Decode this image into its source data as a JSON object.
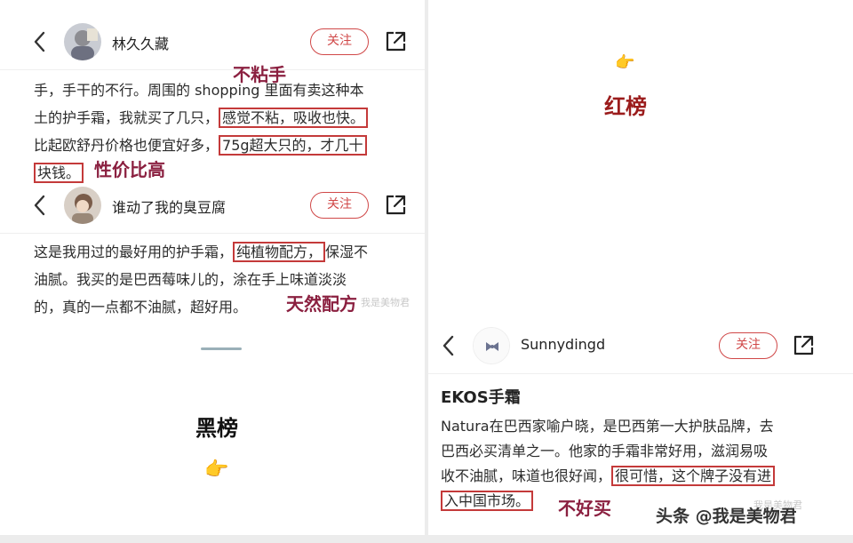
{
  "post1": {
    "username": "林久久藏",
    "follow_label": "关注",
    "lines": [
      {
        "segments": [
          {
            "t": "手，手干的不行。周围的 shopping 里面有卖这种本",
            "hl": false
          }
        ]
      },
      {
        "segments": [
          {
            "t": "土的护手霜，我就买了几只，",
            "hl": false
          },
          {
            "t": "感觉不粘，吸收也快。",
            "hl": true
          }
        ]
      },
      {
        "segments": [
          {
            "t": "比起欧舒丹价格也便宜好多，",
            "hl": false
          },
          {
            "t": "75g超大只的，才几十",
            "hl": true
          }
        ]
      },
      {
        "segments": [
          {
            "t": "块钱。",
            "hl": true
          }
        ]
      }
    ],
    "annotation_top": "不粘手",
    "annotation_price": "性价比高"
  },
  "post2": {
    "username": "谁动了我的臭豆腐",
    "follow_label": "关注",
    "lines": [
      {
        "segments": [
          {
            "t": "这是我用过的最好用的护手霜，",
            "hl": false
          },
          {
            "t": "纯植物配方，",
            "hl": true
          },
          {
            "t": "保湿不",
            "hl": false
          }
        ]
      },
      {
        "segments": [
          {
            "t": "油腻。我买的是巴西莓味儿的，涂在手上味道淡淡",
            "hl": false
          }
        ]
      },
      {
        "segments": [
          {
            "t": "的，真的一点都不油腻，超好用。",
            "hl": false
          }
        ]
      }
    ],
    "annotation": "天然配方",
    "watermark": "我是美物君"
  },
  "black_list_label": "黑榜",
  "red_list_label": "红榜",
  "post3": {
    "username": "Sunnydingd",
    "follow_label": "关注",
    "product_title": "EKOS手霜",
    "lines": [
      {
        "segments": [
          {
            "t": "Natura在巴西家喻户晓，是巴西第一大护肤品牌，去",
            "hl": false
          }
        ]
      },
      {
        "segments": [
          {
            "t": "巴西必买清单之一。他家的手霜非常好用，滋润易吸",
            "hl": false
          }
        ]
      },
      {
        "segments": [
          {
            "t": "收不油腻，味道也很好闻，",
            "hl": false
          },
          {
            "t": "很可惜，这个牌子没有进",
            "hl": true
          }
        ]
      },
      {
        "segments": [
          {
            "t": "入中国市场。",
            "hl": true
          }
        ]
      }
    ],
    "annotation": "不好买",
    "watermark": "我是美物君"
  },
  "footer_watermark": "头条 @我是美物君",
  "colors": {
    "accent_red": "#d04848",
    "box_red": "#c43a3a",
    "annotation": "#8b2040",
    "rank_red": "#9b1c1c"
  },
  "icons": {
    "back": "chevron-left-icon",
    "share": "share-icon",
    "hand": "pointing-hand-icon"
  }
}
